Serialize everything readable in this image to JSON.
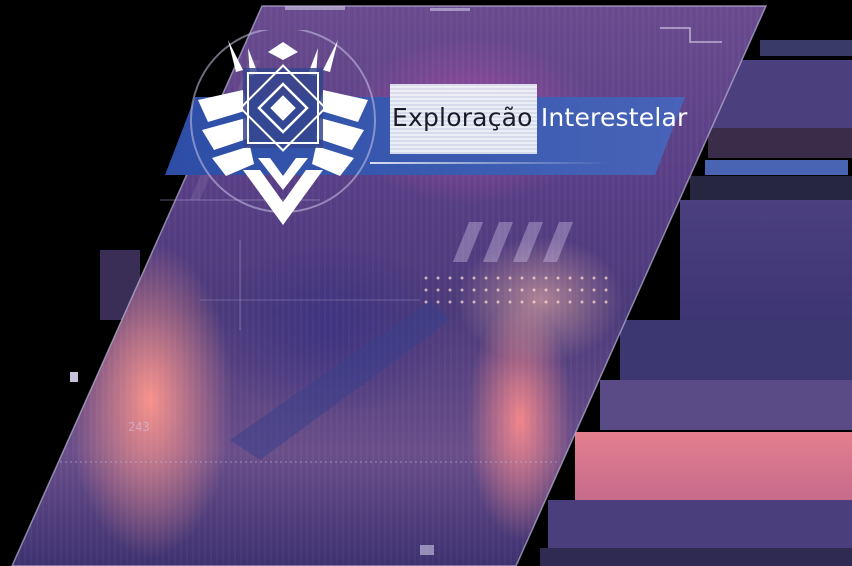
{
  "banner": {
    "title_part1": "Exploração",
    "title_part2": " Interestelar"
  },
  "hud": {
    "code": "243"
  },
  "icons": {
    "emblem": "winged-crest-emblem-icon"
  },
  "colors": {
    "banner_blue": "#3a5bb0",
    "panel_purple": "#5a3f86",
    "glow_pink": "#ff8c96",
    "emblem_white": "#ffffff"
  }
}
